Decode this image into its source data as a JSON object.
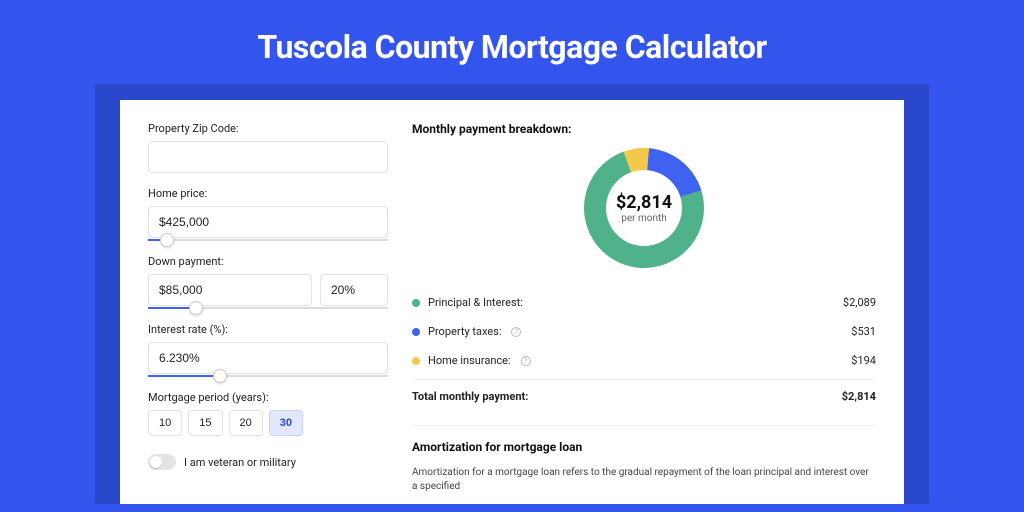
{
  "title": "Tuscola County Mortgage Calculator",
  "form": {
    "zip_label": "Property Zip Code:",
    "zip_value": "",
    "home_price_label": "Home price:",
    "home_price_value": "$425,000",
    "home_price_slider_pct": 8,
    "down_payment_label": "Down payment:",
    "down_payment_value": "$85,000",
    "down_payment_pct_value": "20%",
    "down_payment_slider_pct": 20,
    "interest_label": "Interest rate (%):",
    "interest_value": "6.230%",
    "interest_slider_pct": 30,
    "period_label": "Mortgage period (years):",
    "periods": [
      "10",
      "15",
      "20",
      "30"
    ],
    "period_selected": "30",
    "veteran_label": "I am veteran or military"
  },
  "breakdown": {
    "title": "Monthly payment breakdown:",
    "center_value": "$2,814",
    "center_sub": "per month",
    "items": [
      {
        "label": "Principal & Interest:",
        "value": "$2,089",
        "color": "#4fb28b",
        "info": false,
        "num": 2089
      },
      {
        "label": "Property taxes:",
        "value": "$531",
        "color": "#3f63f0",
        "info": true,
        "num": 531
      },
      {
        "label": "Home insurance:",
        "value": "$194",
        "color": "#f3c94c",
        "info": true,
        "num": 194
      }
    ],
    "total_label": "Total monthly payment:",
    "total_value": "$2,814"
  },
  "amort": {
    "title": "Amortization for mortgage loan",
    "text": "Amortization for a mortgage loan refers to the gradual repayment of the loan principal and interest over a specified"
  },
  "chart_data": {
    "type": "pie",
    "title": "Monthly payment breakdown",
    "categories": [
      "Principal & Interest",
      "Property taxes",
      "Home insurance"
    ],
    "values": [
      2089,
      531,
      194
    ],
    "colors": [
      "#4fb28b",
      "#3f63f0",
      "#f3c94c"
    ],
    "total": 2814
  }
}
